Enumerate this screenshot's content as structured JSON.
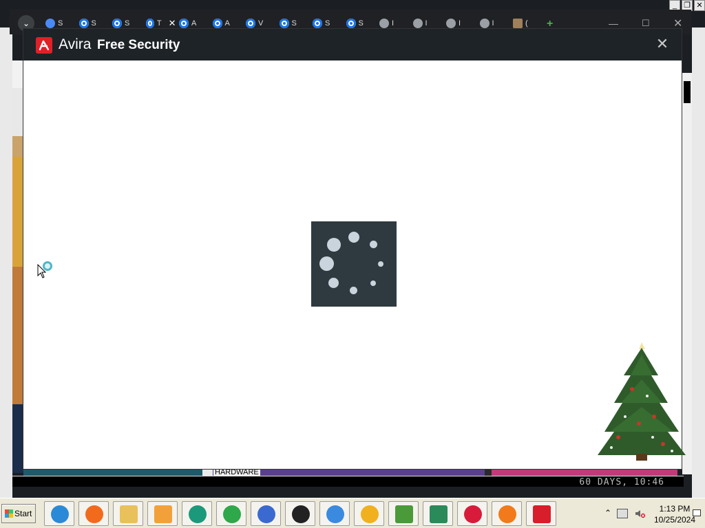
{
  "browser": {
    "tabs": [
      {
        "icon": "gear-icon",
        "label": "S"
      },
      {
        "icon": "avira-icon",
        "label": "S"
      },
      {
        "icon": "avira-icon",
        "label": "S"
      },
      {
        "icon": "avira-icon",
        "label": "T"
      },
      {
        "icon": "avira-icon",
        "label": "A"
      },
      {
        "icon": "avira-icon",
        "label": "A"
      },
      {
        "icon": "avira-icon",
        "label": "V"
      },
      {
        "icon": "avira-icon",
        "label": "S"
      },
      {
        "icon": "avira-icon",
        "label": "S"
      },
      {
        "icon": "target-icon",
        "label": "S"
      },
      {
        "icon": "globe-icon",
        "label": "I"
      },
      {
        "icon": "globe-icon",
        "label": "I"
      },
      {
        "icon": "globe-icon",
        "label": "I"
      },
      {
        "icon": "globe-icon",
        "label": "I"
      },
      {
        "icon": "folder-icon",
        "label": "("
      }
    ],
    "close_glyph": "✕",
    "new_tab_glyph": "+",
    "minimize_glyph": "—",
    "maximize_glyph": "☐",
    "window_close_glyph": "✕"
  },
  "background_page": {
    "section_label": "HARDWARE",
    "scroll_readout": "60 DAYS, 10:46"
  },
  "avira": {
    "brand": "Avira",
    "product": "Free Security",
    "close_glyph": "✕",
    "accent": "#e02027",
    "titlebar_color": "#1e2327"
  },
  "taskbar": {
    "start_label": "Start",
    "apps": [
      "internet-explorer-icon",
      "firefox-icon",
      "file-explorer-icon",
      "media-player-icon",
      "chat-icon",
      "green-app-icon",
      "network-icon",
      "ninja-icon",
      "blue-browser-icon",
      "chrome-like-icon",
      "avg-icon",
      "monitor-icon",
      "opera-icon",
      "avast-icon",
      "avira-icon"
    ],
    "clock_time": "1:13 PM",
    "clock_date": "10/25/2024"
  }
}
